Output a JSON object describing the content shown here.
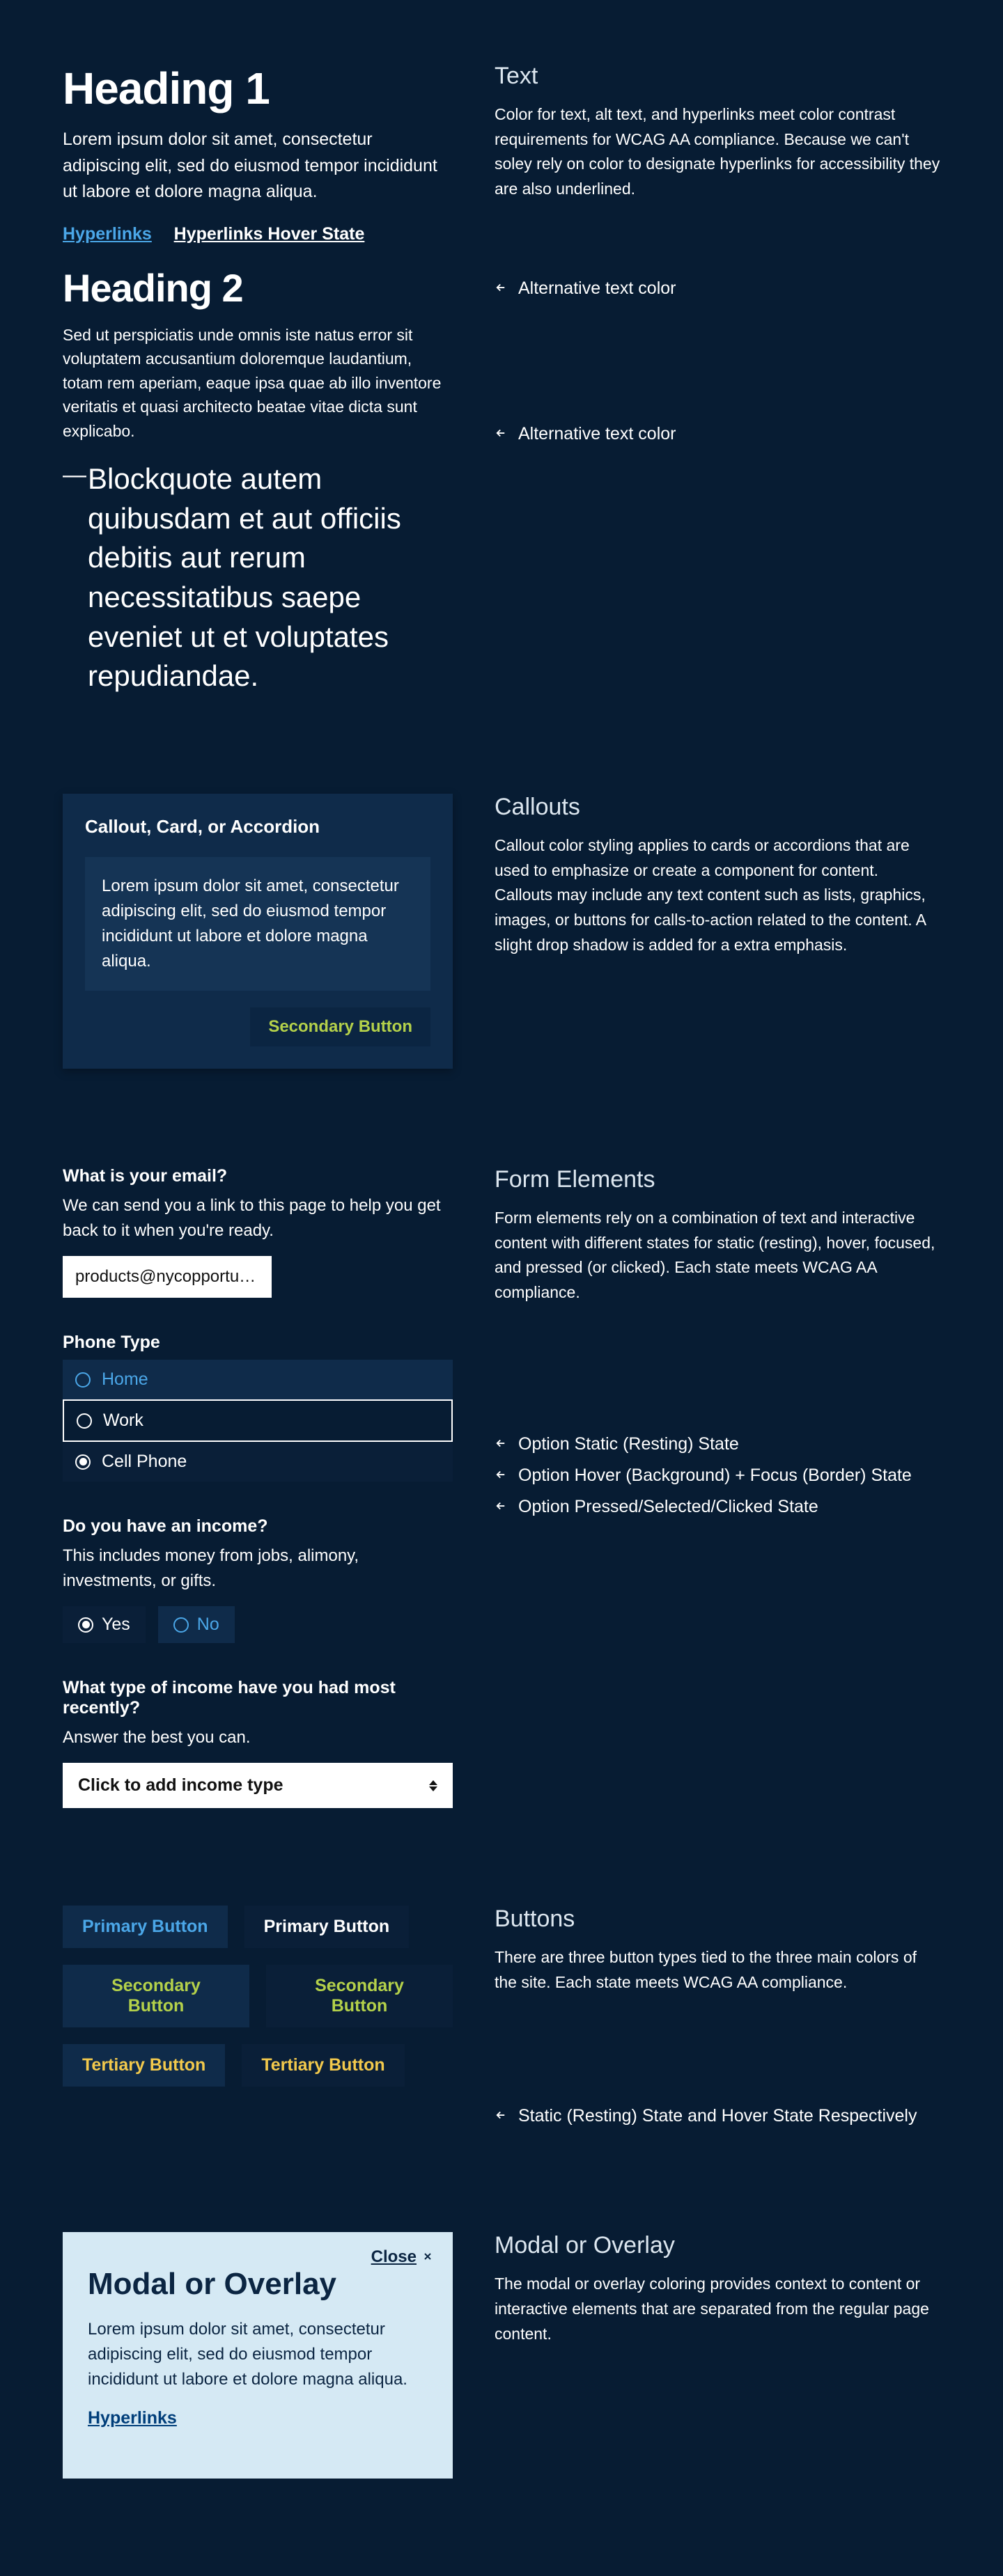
{
  "text_section": {
    "heading1": "Heading 1",
    "body1": "Lorem ipsum dolor sit amet, consectetur adipiscing elit, sed do eiusmod tempor incididunt ut labore et dolore magna aliqua.",
    "link_label": "Hyperlinks",
    "link_hover_label": "Hyperlinks Hover State",
    "heading2": "Heading 2",
    "body2": "Sed ut perspiciatis unde omnis iste natus error sit voluptatem accusantium doloremque laudantium, totam rem aperiam, eaque ipsa quae ab illo inventore veritatis et quasi architecto beatae vitae dicta sunt explicabo.",
    "blockquote": "Blockquote autem quibusdam et aut officiis debitis aut rerum necessitatibus saepe eveniet ut et voluptates repudiandae.",
    "right_title": "Text",
    "right_desc": "Color for text, alt text, and hyperlinks meet color contrast requirements for WCAG AA compliance. Because we can't soley rely on color to designate hyperlinks for accessibility they are also underlined.",
    "alt_text_1": "Alternative text color",
    "alt_text_2": "Alternative text color"
  },
  "callouts": {
    "card_title": "Callout, Card, or Accordion",
    "card_body": "Lorem ipsum dolor sit amet, consectetur adipiscing elit, sed do eiusmod tempor incididunt ut labore et dolore magna aliqua.",
    "card_btn": "Secondary Button",
    "right_title": "Callouts",
    "right_desc": "Callout color styling applies to cards or accordions that are used to emphasize or create a component for content. Callouts may include any text content such as lists, graphics, images, or buttons for calls-to-action related to the content. A slight drop shadow is added for a extra emphasis."
  },
  "form": {
    "email_label": "What is your email?",
    "email_help": "We can send you a link to this page to help you get back to it when you're ready.",
    "email_value": "products@nycopportunity.nyc.g…",
    "phone_label": "Phone Type",
    "opt_home": "Home",
    "opt_work": "Work",
    "opt_cell": "Cell Phone",
    "state_resting": "Option Static (Resting) State",
    "state_hover": "Option Hover (Background) + Focus (Border) State",
    "state_selected": "Option Pressed/Selected/Clicked State",
    "income_label": "Do you have an income?",
    "income_help": "This includes money from jobs, alimony, investments, or gifts.",
    "opt_yes": "Yes",
    "opt_no": "No",
    "income_type_label": "What type of income have you had most recently?",
    "income_type_help": "Answer the best you can.",
    "select_placeholder": "Click to add income type",
    "right_title": "Form Elements",
    "right_desc": "Form elements rely on a combination of text and interactive content with different states for static (resting), hover, focused, and pressed (or clicked). Each state meets WCAG AA compliance."
  },
  "buttons": {
    "primary": "Primary Button",
    "secondary": "Secondary Button",
    "tertiary": "Tertiary Button",
    "right_title": "Buttons",
    "right_desc": "There are three button types tied to the three main colors of the site. Each state meets WCAG AA compliance.",
    "state_note": "Static (Resting) State and Hover State Respectively"
  },
  "modal": {
    "close": "Close",
    "title": "Modal or Overlay",
    "body": "Lorem ipsum dolor sit amet, consectetur adipiscing elit, sed do eiusmod tempor incididunt ut labore et dolore magna aliqua.",
    "link": "Hyperlinks",
    "right_title": "Modal or Overlay",
    "right_desc": "The modal or overlay coloring provides context to content or interactive elements that are separated from the regular page content."
  }
}
